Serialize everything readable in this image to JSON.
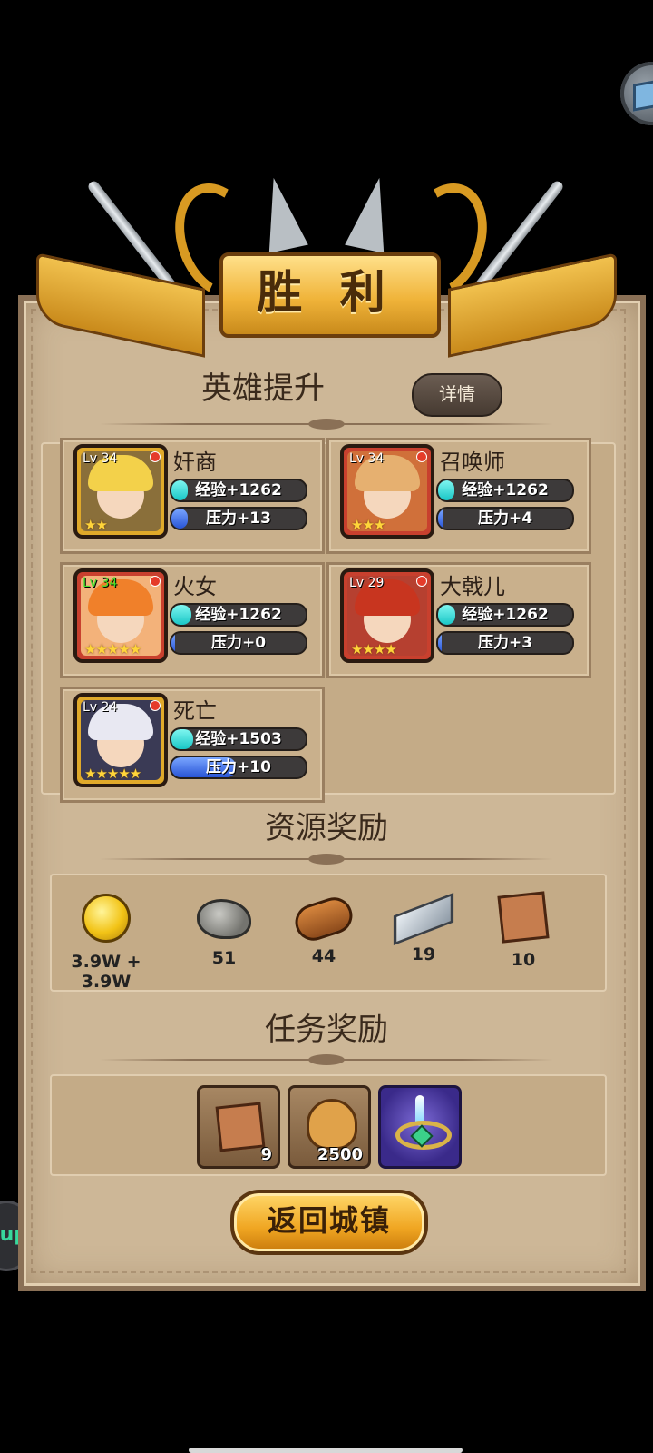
{
  "banner": {
    "title": "胜 利"
  },
  "hero_section": {
    "title": "英雄提升",
    "details_label": "详情",
    "heroes": [
      {
        "name": "奸商",
        "level": "Lv 34",
        "stars": "★★",
        "exp": "经验+1262",
        "exp_fill": 0.12,
        "pressure": "压力+13",
        "pressure_fill": 0.12,
        "frame": "gold"
      },
      {
        "name": "召唤师",
        "level": "Lv 34",
        "stars": "★★★",
        "exp": "经验+1262",
        "exp_fill": 0.12,
        "pressure": "压力+4",
        "pressure_fill": 0.04,
        "frame": "red"
      },
      {
        "name": "火女",
        "level": "Lv 34",
        "stars": "★★★★★",
        "exp": "经验+1262",
        "exp_fill": 0.15,
        "pressure": "压力+0",
        "pressure_fill": 0.0,
        "frame": "red"
      },
      {
        "name": "大戟儿",
        "level": "Lv 29",
        "stars": "★★★★",
        "exp": "经验+1262",
        "exp_fill": 0.13,
        "pressure": "压力+3",
        "pressure_fill": 0.03,
        "frame": "red"
      },
      {
        "name": "死亡",
        "level": "Lv 24",
        "stars": "★★★★★",
        "exp": "经验+1503",
        "exp_fill": 0.16,
        "pressure": "压力+10",
        "pressure_fill": 0.48,
        "frame": "gold"
      }
    ]
  },
  "resource_section": {
    "title": "资源奖励",
    "items": [
      {
        "icon": "gold-coin-icon",
        "value": "3.9W + 3.9W"
      },
      {
        "icon": "stone-icon",
        "value": "51"
      },
      {
        "icon": "wood-log-icon",
        "value": "44"
      },
      {
        "icon": "iron-ingot-icon",
        "value": "19"
      },
      {
        "icon": "scroll-icon",
        "value": "10"
      }
    ]
  },
  "task_section": {
    "title": "任务奖励",
    "items": [
      {
        "icon": "scroll-icon",
        "count": "9"
      },
      {
        "icon": "money-bag-icon",
        "count": "2500"
      },
      {
        "icon": "ring-icon",
        "count": ""
      }
    ]
  },
  "return_label": "返回城镇",
  "side_badge": "up",
  "colors": {
    "exp": "#18c6c6",
    "pressure": "#2854d6",
    "gold": "#f0b43a",
    "parchment": "#cdb797"
  }
}
